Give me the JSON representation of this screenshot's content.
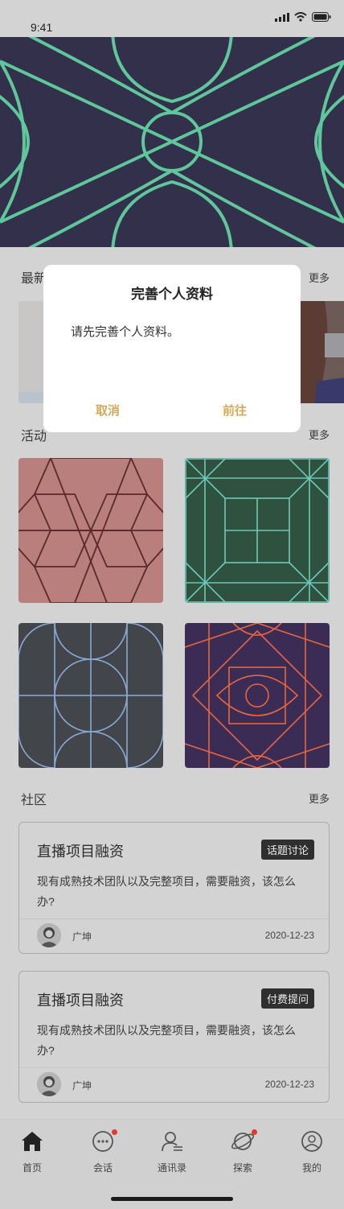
{
  "status_bar": {
    "time": "9:41"
  },
  "sections": {
    "latest": {
      "title": "最新",
      "more": "更多"
    },
    "activity": {
      "title": "活动",
      "more": "更多"
    },
    "community": {
      "title": "社区",
      "more": "更多"
    }
  },
  "posts": [
    {
      "title": "直播项目融资",
      "tag": "话题讨论",
      "body": "现有成熟技术团队以及完整项目，需要融资，该怎么办?",
      "author": "广坤",
      "date": "2020-12-23"
    },
    {
      "title": "直播项目融资",
      "tag": "付费提问",
      "body": "现有成熟技术团队以及完整项目，需要融资，该怎么办?",
      "author": "广坤",
      "date": "2020-12-23"
    }
  ],
  "tabs": [
    {
      "label": "首页",
      "icon": "home-icon",
      "badge": false,
      "active": true
    },
    {
      "label": "会话",
      "icon": "chat-icon",
      "badge": true
    },
    {
      "label": "通讯录",
      "icon": "contacts-icon",
      "badge": false
    },
    {
      "label": "探索",
      "icon": "planet-icon",
      "badge": true
    },
    {
      "label": "我的",
      "icon": "profile-icon",
      "badge": false
    }
  ],
  "dialog": {
    "title": "完善个人资料",
    "message": "请先完善个人资料。",
    "cancel": "取消",
    "confirm": "前往"
  },
  "colors": {
    "banner_bg": "#32304a",
    "banner_line": "#5fc79b",
    "accent": "#d4a85a",
    "badge": "#e23b2e"
  }
}
